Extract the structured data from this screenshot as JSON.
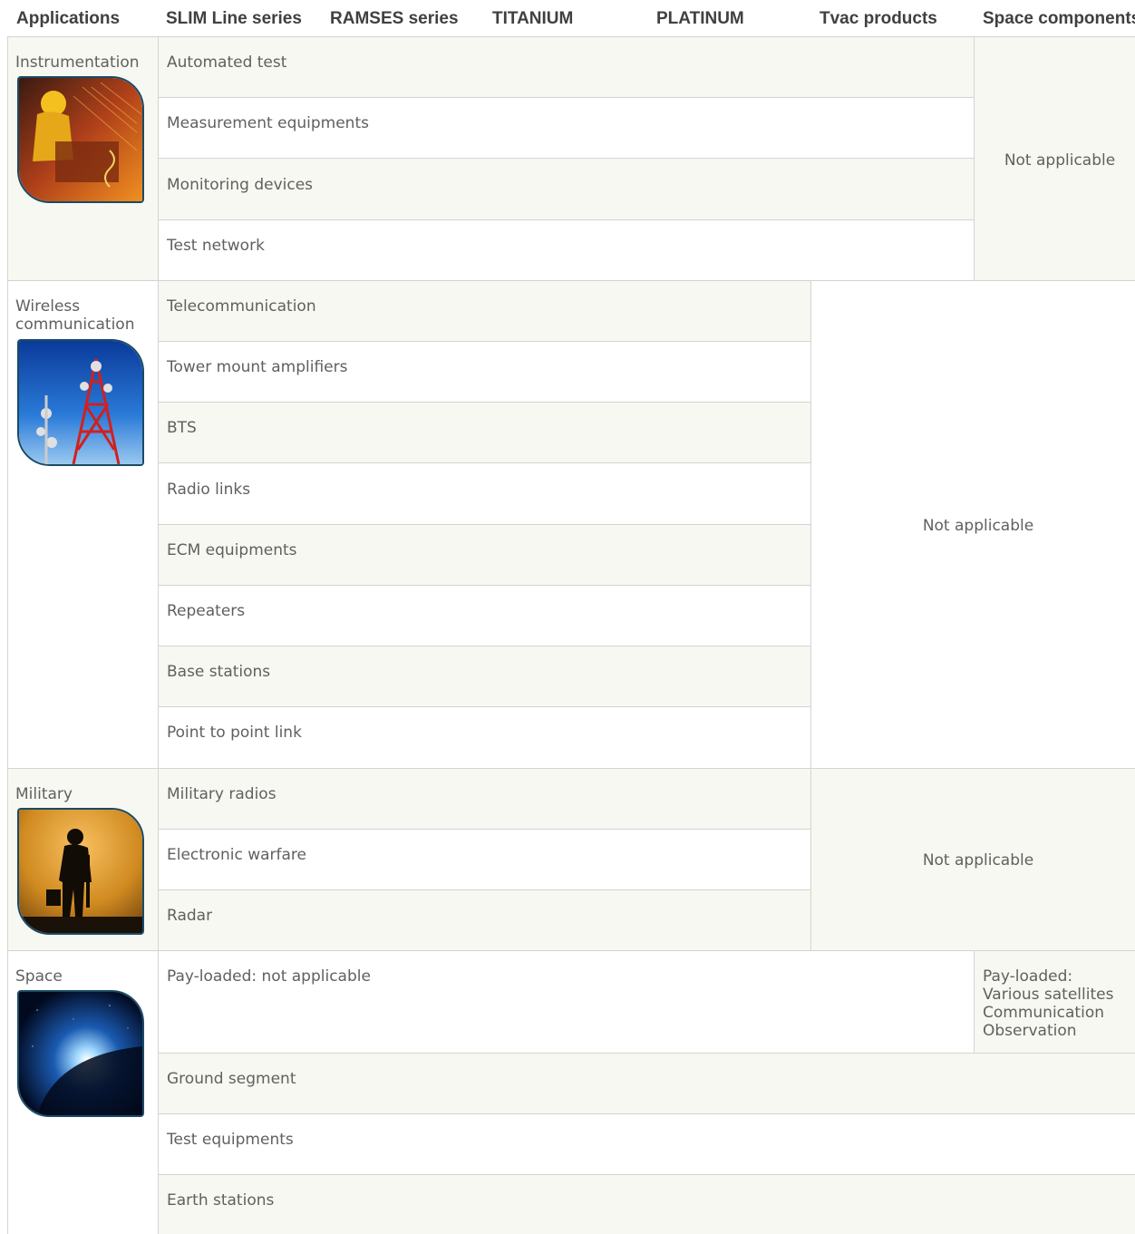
{
  "header": {
    "applications": "Applications",
    "slim": "SLIM Line series",
    "ramses": "RAMSES series",
    "titanium": "TITANIUM",
    "platinum": "PLATINUM",
    "tvac": "Tvac products",
    "space_components": "Space components"
  },
  "instrumentation": {
    "label": "Instrumentation",
    "rows": [
      "Automated test",
      "Measurement equipments",
      "Monitoring devices",
      "Test network"
    ],
    "note": "Not applicable"
  },
  "wireless": {
    "label": "Wireless communication",
    "rows": [
      "Telecommunication",
      "Tower mount amplifiers",
      "BTS",
      "Radio links",
      "ECM equipments",
      "Repeaters",
      "Base stations",
      "Point to point link"
    ],
    "note": "Not applicable"
  },
  "military": {
    "label": "Military",
    "rows": [
      "Military radios",
      "Electronic warfare",
      "Radar"
    ],
    "note": "Not applicable"
  },
  "space": {
    "label": "Space",
    "rows": [
      "Pay-loaded: not applicable",
      "Ground segment",
      "Test equipments",
      "Earth stations"
    ],
    "payloaded": [
      "Pay-loaded:",
      "Various satellites",
      "Communication",
      "Observation"
    ]
  },
  "colors": {
    "shade": "#f8f8f2",
    "border": "#d3d3d3",
    "thumb_border": "#1a4a66"
  }
}
